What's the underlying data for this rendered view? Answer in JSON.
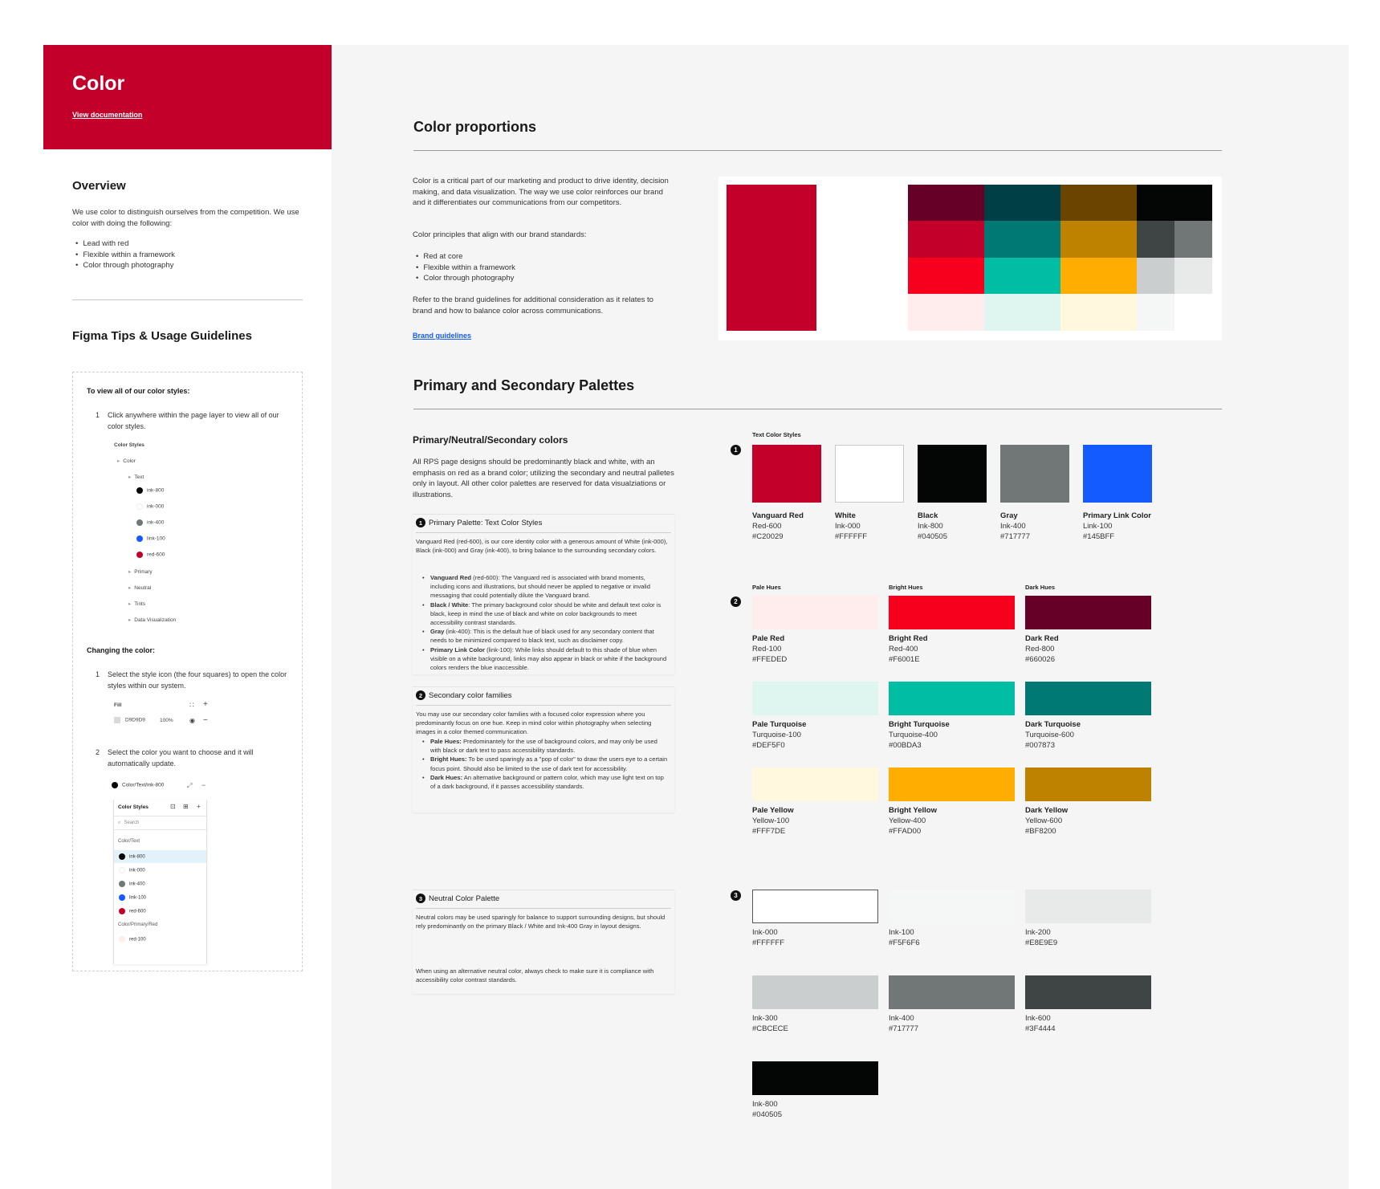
{
  "sidebar": {
    "title": "Color",
    "doc_link": "View documentation",
    "overview_title": "Overview",
    "overview_text": "We use color to distinguish ourselves from the competition. We use color with doing the following:",
    "overview_bullets": [
      "Lead with red",
      "Flexible within a framework",
      "Color through photography"
    ],
    "tips_title": "Figma Tips & Usage Guidelines",
    "tips": {
      "view_heading": "To view all of our color styles:",
      "step1_num": "1",
      "step1": "Click anywhere within the page layer to view all of our color styles.",
      "tree": {
        "root": "Color Styles",
        "color": "Color",
        "text": "Text",
        "items": [
          "ink-800",
          "ink-000",
          "ink-400",
          "link-100",
          "red-600"
        ],
        "others": [
          "Primary",
          "Neutral",
          "Tints",
          "Data Visualization"
        ]
      },
      "change_heading": "Changing the color:",
      "step2_num": "1",
      "step2": "Select the style icon (the four squares) to open the color styles within our system.",
      "fill_label": "Fill",
      "fill_hex": "D9D9D9",
      "fill_pct": "100%",
      "step3_num": "2",
      "step3": "Select the color you want to choose and it will automatically update.",
      "picker": {
        "current": "Color/Text/ink-800",
        "panel_title": "Color Styles",
        "search_placeholder": "Search",
        "group1": "Color/Text",
        "items": [
          "ink-800",
          "ink-000",
          "ink-400",
          "link-100",
          "red-600"
        ],
        "group2": "Color/Primary/Red",
        "items2": [
          "red-100"
        ]
      }
    }
  },
  "main": {
    "proportions_title": "Color proportions",
    "proportions_text": "Color is a critical part of our marketing and product to drive identity, decision making, and data visualization. The way we use color reinforces our brand and it differentiates our communications from our competitors.",
    "principles_intro": "Color principles that align with our brand standards:",
    "principles": [
      "Red at core",
      "Flexible within a framework",
      "Color through photography"
    ],
    "refer_text": "Refer to the brand guidelines for additional consideration as it relates to brand and how to balance color across communications.",
    "brand_link": "Brand guidelines",
    "palettes_title": "Primary and Secondary Palettes",
    "pns_title": "Primary/Neutral/Secondary colors",
    "pns_text": "All RPS page designs should be predominantly black and white, with an emphasis on red as a brand color; utilizing the secondary and neutral palletes only in layout. All other color palettes are reserved for data visualziations or illustrations.",
    "card1": {
      "badge": "1",
      "title": "Primary Palette: Text Color Styles",
      "text": "Vanguard Red (red-600), is our core identity color with a generous amount of White (ink-000), Black (ink-000) and Gray (ink-400), to bring balance to the surrounding secondary colors.",
      "bullets": [
        {
          "b": "Vanguard Red",
          "t": " (red-600): The Vanguard red is associated with brand moments, including icons and illustrations, but should never be applied to negative or invalid messaging that could potentially dilute the Vanguard brand."
        },
        {
          "b": "Black / White",
          "t": ": The primary background color should be white and default text color is black, keep in mind the use of black and white on color backgrounds to meet accessibility contrast standards."
        },
        {
          "b": "Gray",
          "t": " (ink-400): This is the default hue of black used for any secondary content that needs to be minimized compared to black text, such as disclaimer copy."
        },
        {
          "b": "Primary Link Color",
          "t": " (link-100): While links should default to this shade of blue when visible on a white background, links may also appear in black or white if the background colors renders the blue inaccessible."
        }
      ]
    },
    "card2": {
      "badge": "2",
      "title": "Secondary color families",
      "text": "You may use our secondary color families with a focused color expression where you predominantly focus on one hue. Keep in mind color within photography when selecting images in a color themed communication.",
      "bullets": [
        {
          "b": "Pale Hues:",
          "t": " Predominantely for the use of background colors, and may only be used with black or dark text to pass accessibility standards."
        },
        {
          "b": "Bright Hues:",
          "t": " To be used sparingly as a \"pop of color\" to draw the users eye to a certain focus point. Should also be limited to the use of dark text for accessibility."
        },
        {
          "b": "Dark Hues:",
          "t": " An alternative background or pattern color, which may use light text on top of a dark background, if it passes accessibility standards."
        }
      ]
    },
    "card3": {
      "badge": "3",
      "title": "Neutral Color Palette",
      "text": "Neutral colors may be used sparingly for balance to support surrounding designs, but should rely predominantly on the primary Black / White and Ink-400 Gray in layout designs.",
      "text2": "When using an alternative neutral color, always check to make sure it is compliance with accessibility color contrast standards."
    },
    "text_styles_label": "Text Color Styles",
    "group1_badge": "1",
    "group2_badge": "2",
    "group3_badge": "3",
    "pale_label": "Pale Hues",
    "bright_label": "Bright Hues",
    "dark_label": "Dark Hues",
    "text_swatches": [
      {
        "name": "Vanguard Red",
        "token": "Red-600",
        "hex": "#C20029"
      },
      {
        "name": "White",
        "token": "Ink-000",
        "hex": "#FFFFFF"
      },
      {
        "name": "Black",
        "token": "Ink-800",
        "hex": "#040505"
      },
      {
        "name": "Gray",
        "token": "Ink-400",
        "hex": "#717777"
      },
      {
        "name": "Primary Link Color",
        "token": "Link-100",
        "hex": "#145BFF"
      }
    ],
    "secondary_swatches": [
      {
        "name": "Pale Red",
        "token": "Red-100",
        "hex": "#FFEDED"
      },
      {
        "name": "Bright Red",
        "token": "Red-400",
        "hex": "#F6001E"
      },
      {
        "name": "Dark Red",
        "token": "Red-800",
        "hex": "#660026"
      },
      {
        "name": "Pale Turquoise",
        "token": "Turquoise-100",
        "hex": "#DEF5F0"
      },
      {
        "name": "Bright Turquoise",
        "token": "Turquoise-400",
        "hex": "#00BDA3"
      },
      {
        "name": "Dark Turquoise",
        "token": "Turquoise-600",
        "hex": "#007873"
      },
      {
        "name": "Pale Yellow",
        "token": "Yellow-100",
        "hex": "#FFF7DE"
      },
      {
        "name": "Bright Yellow",
        "token": "Yellow-400",
        "hex": "#FFAD00"
      },
      {
        "name": "Dark Yellow",
        "token": "Yellow-600",
        "hex": "#BF8200"
      }
    ],
    "neutral_swatches": [
      {
        "token": "Ink-000",
        "hex": "#FFFFFF"
      },
      {
        "token": "Ink-100",
        "hex": "#F5F6F6"
      },
      {
        "token": "Ink-200",
        "hex": "#E8E9E9"
      },
      {
        "token": "Ink-300",
        "hex": "#CBCECE"
      },
      {
        "token": "Ink-400",
        "hex": "#717777"
      },
      {
        "token": "Ink-600",
        "hex": "#3F4444"
      },
      {
        "token": "Ink-800",
        "hex": "#040505"
      }
    ]
  }
}
